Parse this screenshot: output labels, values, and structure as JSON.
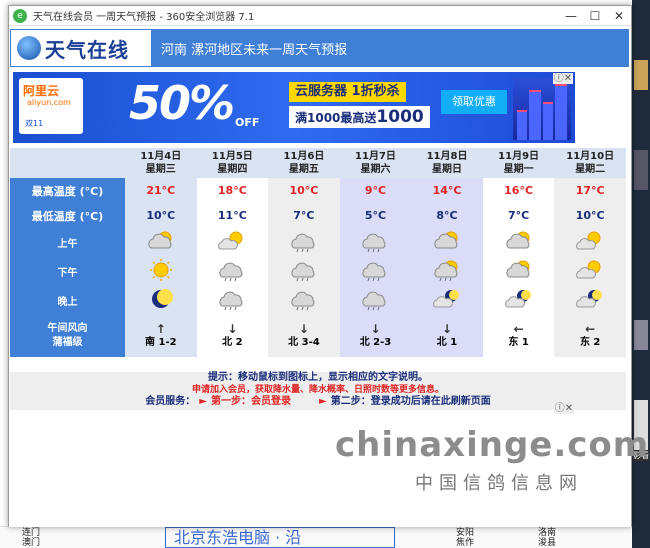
{
  "window": {
    "title": "天气在线会员 一周天气预报 - 360安全浏览器 7.1",
    "minimize": "—",
    "maximize": "☐",
    "close": "✕"
  },
  "header": {
    "logo_text": "天气在线",
    "title": "河南 漯河地区未来一周天气预报"
  },
  "ad": {
    "logo_main": "阿里云",
    "logo_sub": "aliyun.com",
    "logo_tag": "双11",
    "big_text": "50%",
    "off_text": "OFF",
    "line1": "云服务器 1折秒杀",
    "line2_prefix": "满1000最高送",
    "line2_amount": "1000",
    "button": "领取优惠",
    "close": "ⓘ✕"
  },
  "forecast": {
    "days": [
      {
        "date": "11月4日",
        "weekday": "星期三",
        "high": "21°C",
        "low": "10°C",
        "am": "partly-cloudy",
        "pm": "sunny",
        "night": "moon",
        "wind_arrow": "↑",
        "wind": "南 1-2"
      },
      {
        "date": "11月5日",
        "weekday": "星期四",
        "high": "18°C",
        "low": "11°C",
        "am": "partly-cloudy-light",
        "pm": "cloud-rain",
        "night": "cloud-rain",
        "wind_arrow": "↓",
        "wind": "北 2"
      },
      {
        "date": "11月6日",
        "weekday": "星期五",
        "high": "10°C",
        "low": "7°C",
        "am": "cloud-rain",
        "pm": "cloud-rain",
        "night": "cloud-rain",
        "wind_arrow": "↓",
        "wind": "北 3-4"
      },
      {
        "date": "11月7日",
        "weekday": "星期六",
        "high": "9°C",
        "low": "5°C",
        "am": "cloud-rain",
        "pm": "cloud-rain",
        "night": "cloud-rain",
        "wind_arrow": "↓",
        "wind": "北 2-3"
      },
      {
        "date": "11月8日",
        "weekday": "星期日",
        "high": "14°C",
        "low": "8°C",
        "am": "partly-cloudy",
        "pm": "partly-cloudy-rain",
        "night": "moon-cloud",
        "wind_arrow": "↓",
        "wind": "北 1"
      },
      {
        "date": "11月9日",
        "weekday": "星期一",
        "high": "16°C",
        "low": "7°C",
        "am": "partly-cloudy",
        "pm": "partly-cloudy",
        "night": "moon-cloud",
        "wind_arrow": "←",
        "wind": "东 1"
      },
      {
        "date": "11月10日",
        "weekday": "星期二",
        "high": "17°C",
        "low": "10°C",
        "am": "partly-cloudy-light",
        "pm": "partly-cloudy-light",
        "night": "moon-cloud",
        "wind_arrow": "←",
        "wind": "东 2"
      }
    ],
    "labels": {
      "high": "最高温度 (°C)",
      "low": "最低温度 (°C)",
      "am": "上午",
      "pm": "下午",
      "night": "晚上",
      "wind1": "午间风向",
      "wind2": "蒲福级"
    }
  },
  "notes": {
    "hint": "提示：移动鼠标到图标上，显示相应的文字说明。",
    "member_join": "申请加入会员，获取降水量、降水概率、日照时数等更多信息。",
    "service_label": "会员服务：",
    "step1_arrow": "►",
    "step1": "第一步：会员登录",
    "step2_arrow": "►",
    "step2": "第二步：登录成功后请在此刷新页面"
  },
  "watermark": {
    "site": "chinaxinge.com",
    "name": "中国信鸽信息网"
  },
  "ad2_close": "ⓘ✕",
  "background": {
    "bottom_left_1": "连门",
    "bottom_left_2": "澳门",
    "bottom_banner": "北京东浩电脑 · 沿",
    "bottom_mid_1": "安阳",
    "bottom_mid_2": "焦作",
    "bottom_mid2_1": "洛南",
    "bottom_mid2_2": "浚县",
    "right_label": "影看"
  }
}
